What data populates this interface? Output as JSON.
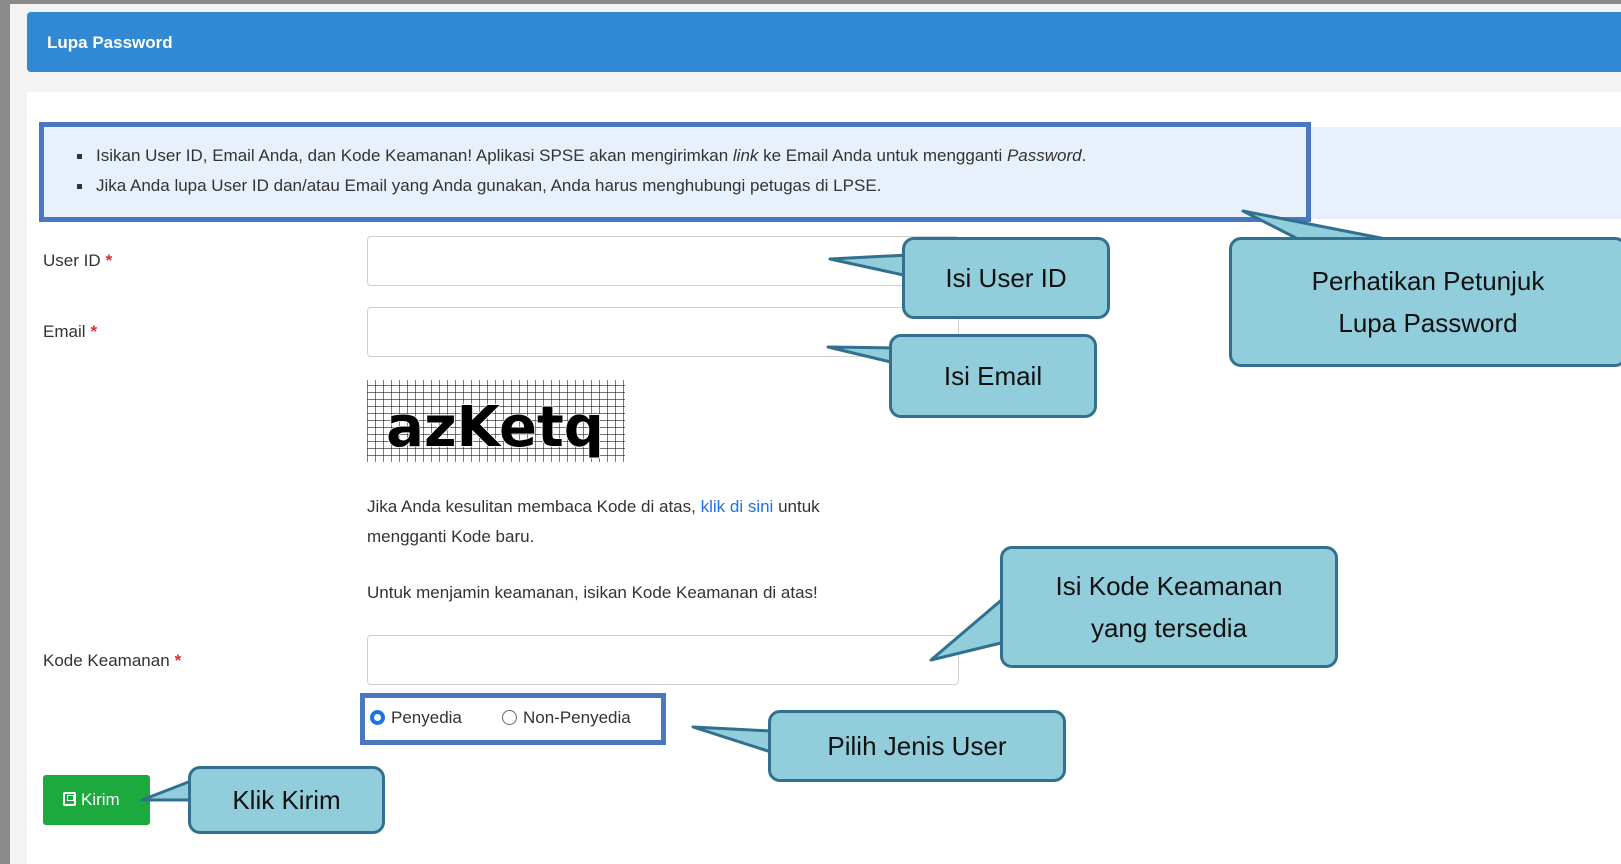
{
  "panel": {
    "title": "Lupa Password"
  },
  "info": {
    "line1_a": "Isikan User ID, Email Anda, dan Kode Keamanan! Aplikasi SPSE akan mengirimkan ",
    "line1_link_em": "link",
    "line1_b": " ke Email Anda untuk mengganti ",
    "line1_password_em": "Password",
    "line1_end": ".",
    "line2": "Jika Anda lupa User ID dan/atau Email yang Anda gunakan, Anda harus menghubungi petugas di LPSE."
  },
  "form": {
    "user_id_label": "User ID",
    "email_label": "Email",
    "required_mark": "*",
    "captcha_text": "azKetq",
    "help_a": "Jika Anda kesulitan membaca Kode di atas, ",
    "help_link": "klik di sini",
    "help_b": " untuk",
    "help_line2": "mengganti Kode baru.",
    "help_line3": "Untuk menjamin keamanan, isikan Kode Keamanan di atas!",
    "kode_label": "Kode Keamanan",
    "radio_options": [
      "Penyedia",
      "Non-Penyedia"
    ],
    "radio_selected": "Penyedia",
    "submit_label": "Kirim"
  },
  "callouts": {
    "user_id": "Isi User ID",
    "email": "Isi Email",
    "petunjuk": "Perhatikan Petunjuk\nLupa Password",
    "kode": "Isi Kode Keamanan\nyang tersedia",
    "jenis": "Pilih Jenis User",
    "kirim": "Klik Kirim"
  },
  "colors": {
    "header": "#3089d2",
    "callout_fill": "#92cddc",
    "callout_border": "#31708f",
    "highlight_border": "#4a78c0",
    "submit": "#1ca93e",
    "link": "#1a73e8"
  }
}
